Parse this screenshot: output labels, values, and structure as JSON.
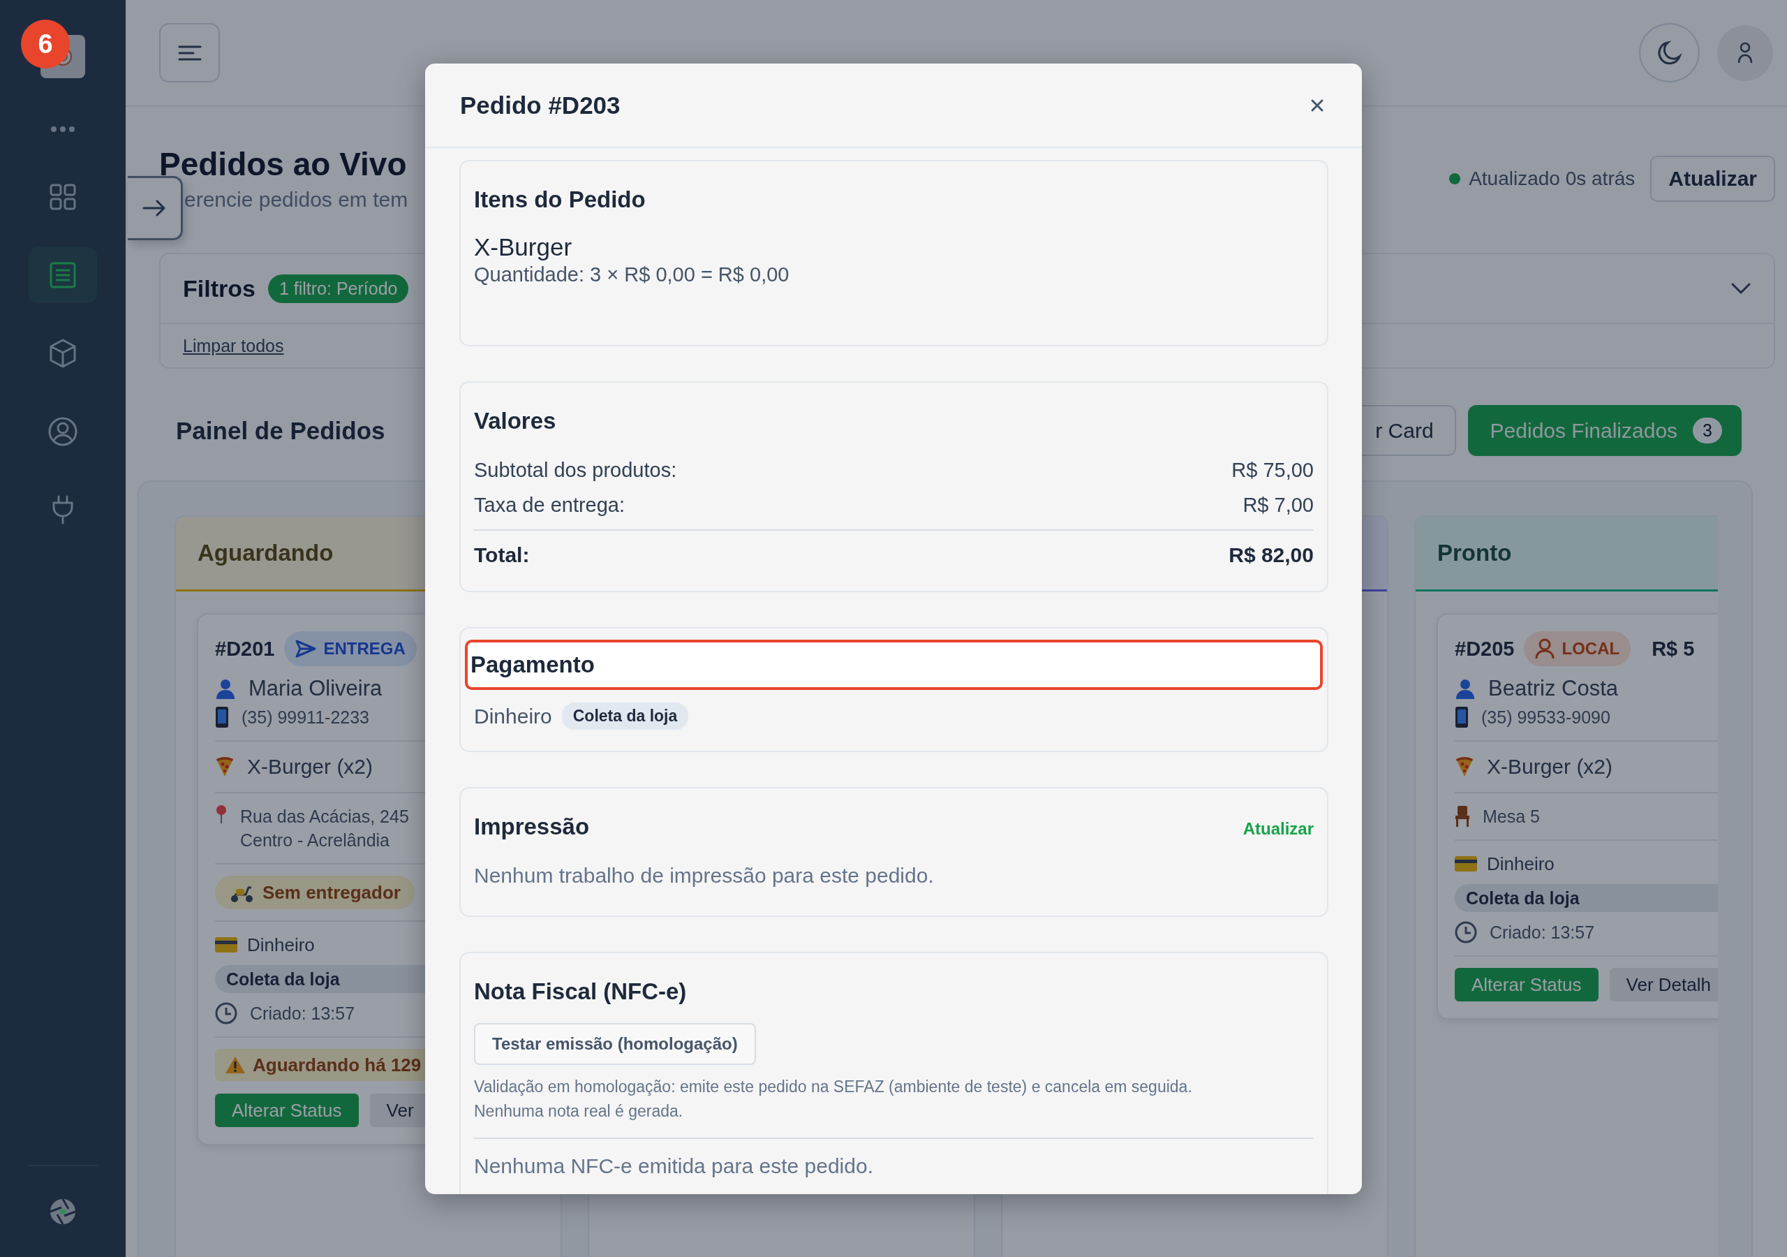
{
  "tour": {
    "step": "6"
  },
  "sidebar": {
    "items": [
      {
        "kind": "more",
        "selected": false
      },
      {
        "kind": "grid",
        "selected": false
      },
      {
        "kind": "list",
        "selected": true
      },
      {
        "kind": "box",
        "selected": false
      },
      {
        "kind": "user",
        "selected": false
      },
      {
        "kind": "plug",
        "selected": false
      }
    ]
  },
  "header": {
    "title": "Pedidos ao Vivo",
    "subtitle": "erencie pedidos em tem",
    "status": "Atualizado 0s atrás",
    "refresh_button": "Atualizar"
  },
  "filters": {
    "title": "Filtros",
    "badge": "1 filtro: Período",
    "clear_link": "Limpar todos",
    "expanded": false
  },
  "board": {
    "title": "Painel de Pedidos",
    "buttons": [
      {
        "label": "r Card",
        "kind": "outline"
      },
      {
        "label": "Pedidos Finalizados",
        "count": "3",
        "kind": "primary"
      }
    ],
    "columns": [
      {
        "title": "Aguardando",
        "color": "#8e720f",
        "cards": [
          {
            "id": "#D201",
            "type": {
              "kind": "delivery",
              "label": "ENTREGA"
            },
            "rows": [
              {
                "kind": "customer",
                "text": "Maria Oliveira"
              },
              {
                "kind": "phone",
                "text": "(35) 99911-2233"
              },
              {
                "kind": "item",
                "text": "X-Burger (x2)"
              },
              {
                "kind": "address",
                "lines": [
                  "Rua das Acácias, 245",
                  "Centro - Acrelândia"
                ]
              },
              {
                "kind": "courier",
                "text": "Sem entregador"
              },
              {
                "kind": "payment",
                "text": "Dinheiro"
              },
              {
                "kind": "pickup",
                "text": "Coleta da loja"
              },
              {
                "kind": "created",
                "text": "Criado: 13:57"
              }
            ],
            "warning": "Aguardando há 129",
            "actions": [
              {
                "label": "Alterar Status",
                "kind": "primary"
              },
              {
                "label": "Ver",
                "kind": "secondary"
              }
            ]
          }
        ]
      },
      {},
      {
        "color": "#40459d"
      },
      {
        "title": "Pronto",
        "color": "#10755d",
        "cards": [
          {
            "id": "#D205",
            "type": {
              "kind": "local",
              "label": "LOCAL"
            },
            "price": "R$ 5",
            "rows": [
              {
                "kind": "customer",
                "text": "Beatriz Costa"
              },
              {
                "kind": "phone",
                "text": "(35) 99533-9090"
              },
              {
                "kind": "item",
                "text": "X-Burger (x2)"
              },
              {
                "kind": "table",
                "text": "Mesa 5"
              },
              {
                "kind": "payment",
                "text": "Dinheiro"
              },
              {
                "kind": "pickup",
                "text": "Coleta da loja"
              },
              {
                "kind": "created",
                "text": "Criado: 13:57"
              }
            ],
            "actions": [
              {
                "label": "Alterar Status",
                "kind": "primary"
              },
              {
                "label": "Ver Detalh",
                "kind": "secondary"
              }
            ]
          }
        ]
      }
    ]
  },
  "modal": {
    "title": "Pedido #D203",
    "sections": [
      {
        "kind": "items",
        "title": "Itens do Pedido",
        "items": [
          {
            "name": "X-Burger",
            "detail": "Quantidade: 3 × R$ 0,00 = R$ 0,00"
          }
        ]
      },
      {
        "kind": "totals",
        "title": "Valores",
        "rows": [
          {
            "label": "Subtotal dos produtos:",
            "value": "R$ 75,00"
          },
          {
            "label": "Taxa de entrega:",
            "value": "R$ 7,00"
          }
        ],
        "total": {
          "label": "Total:",
          "value": "R$ 82,00"
        }
      },
      {
        "kind": "payment",
        "title": "Pagamento",
        "highlighted": true,
        "method": "Dinheiro",
        "tag": "Coleta da loja"
      },
      {
        "kind": "print",
        "title": "Impressão",
        "action": "Atualizar",
        "text": "Nenhum trabalho de impressão para este pedido."
      },
      {
        "kind": "invoice",
        "title": "Nota Fiscal (NFC-e)",
        "button": "Testar emissão (homologação)",
        "note_lines": [
          "Validação em homologação: emite este pedido na SEFAZ (ambiente de teste) e cancela em seguida.",
          "Nenhuma nota real é gerada."
        ],
        "text": "Nenhuma NFC-e emitida para este pedido."
      }
    ]
  }
}
